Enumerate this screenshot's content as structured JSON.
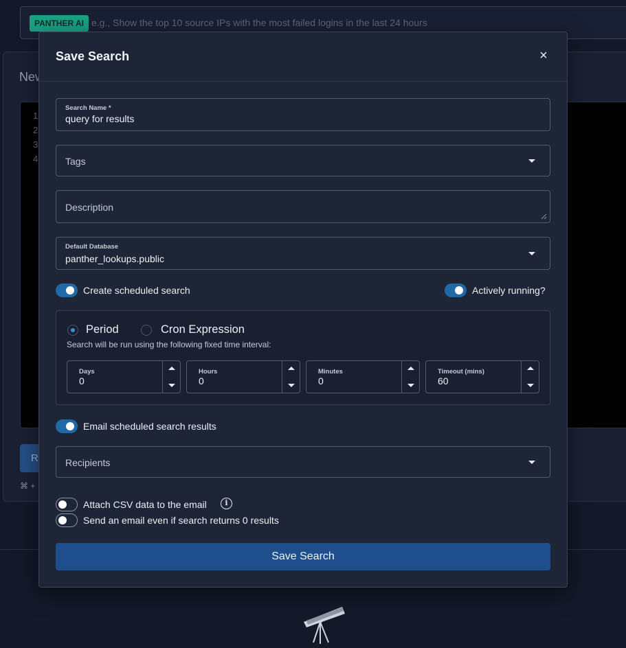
{
  "background": {
    "ai_badge": "PANTHER AI",
    "ai_placeholder": "e.g., Show the top 10 source IPs with the most failed logins in the last 24 hours",
    "new_label": "New",
    "line_numbers": [
      "1",
      "2",
      "3",
      "4"
    ],
    "run_button_label": "R",
    "shortcut_hint": "⌘ +"
  },
  "modal": {
    "title": "Save Search",
    "close_symbol": "×",
    "search_name": {
      "label": "Search Name *",
      "value": "query for results"
    },
    "tags": {
      "label": "Tags"
    },
    "description": {
      "placeholder": "Description"
    },
    "default_database": {
      "label": "Default Database",
      "value": "panther_lookups.public"
    },
    "create_scheduled": {
      "label": "Create scheduled search",
      "on": true
    },
    "actively_running": {
      "label": "Actively running?",
      "on": true
    },
    "schedule": {
      "period_label": "Period",
      "cron_label": "Cron Expression",
      "selected": "Period",
      "hint": "Search will be run using the following fixed time interval:",
      "fields": [
        {
          "label": "Days",
          "value": "0"
        },
        {
          "label": "Hours",
          "value": "0"
        },
        {
          "label": "Minutes",
          "value": "0"
        },
        {
          "label": "Timeout (mins)",
          "value": "60"
        }
      ]
    },
    "email_results": {
      "label": "Email scheduled search results",
      "on": true
    },
    "recipients": {
      "label": "Recipients"
    },
    "attach_csv": {
      "label": "Attach CSV data to the email",
      "on": false
    },
    "send_empty": {
      "label": "Send an email even if search returns 0 results",
      "on": false
    },
    "info_symbol": "i",
    "save_button": "Save Search"
  },
  "colors": {
    "accent": "#1e69a6",
    "primary_button": "#1e4f8c",
    "badge": "#1aa184",
    "modal_bg": "#1e2537",
    "page_bg": "#14192a"
  }
}
